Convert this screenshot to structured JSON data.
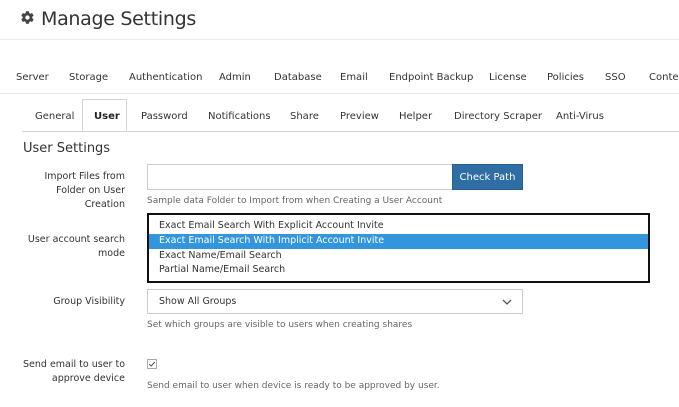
{
  "page": {
    "title": "Manage Settings"
  },
  "top_tabs": [
    "Server",
    "Storage",
    "Authentication",
    "Admin",
    "Database",
    "Email",
    "Endpoint Backup",
    "License",
    "Policies",
    "SSO",
    "Conter"
  ],
  "sub_tabs": [
    "General",
    "User",
    "Password",
    "Notifications",
    "Share",
    "Preview",
    "Helper",
    "Directory Scraper",
    "Anti-Virus"
  ],
  "active_sub_tab": "User",
  "section": {
    "title": "User Settings"
  },
  "import_files": {
    "label_lines": [
      "Import Files from",
      "Folder on User",
      "Creation"
    ],
    "value": "",
    "button_label": "Check Path",
    "help": "Sample data Folder to Import from when Creating a User Account"
  },
  "search_mode": {
    "label_lines": [
      "User account search",
      "mode"
    ],
    "options": [
      "Exact Email Search With Explicit Account Invite",
      "Exact Email Search With Implicit Account Invite",
      "Exact Name/Email Search",
      "Partial Name/Email Search"
    ],
    "selected": "Exact Email Search With Implicit Account Invite"
  },
  "group_visibility": {
    "label": "Group Visibility",
    "value": "Show All Groups",
    "help": "Set which groups are visible to users when creating shares"
  },
  "send_email": {
    "label_lines": [
      "Send email to user to",
      "approve device"
    ],
    "checked": true,
    "help": "Send email to user when device is ready to be approved by user."
  },
  "colors": {
    "primary_button": "#2f6ea5",
    "selected_option": "#3396dd"
  },
  "icons": {
    "title": "gear-icon",
    "select": "chevron-down-icon",
    "checkbox": "check-icon"
  }
}
